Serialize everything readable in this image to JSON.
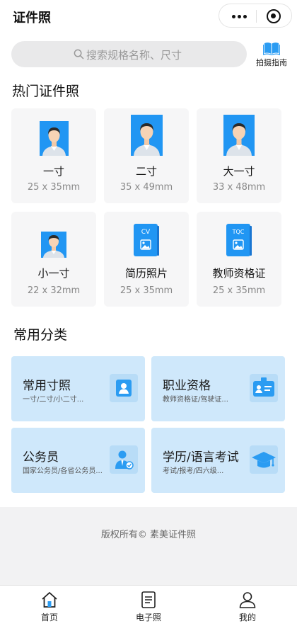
{
  "header": {
    "title": "证件照"
  },
  "search": {
    "placeholder": "搜索规格名称、尺寸"
  },
  "guide": {
    "label": "拍摄指南"
  },
  "hot": {
    "title": "热门证件照",
    "items": [
      {
        "name": "一寸",
        "size": "25 x 35mm"
      },
      {
        "name": "二寸",
        "size": "35 x 49mm"
      },
      {
        "name": "大一寸",
        "size": "33 x 48mm"
      },
      {
        "name": "小一寸",
        "size": "22 x 32mm"
      },
      {
        "name": "简历照片",
        "size": "25 x 35mm",
        "badge": "CV"
      },
      {
        "name": "教师资格证",
        "size": "25 x 35mm",
        "badge": "TQC"
      }
    ]
  },
  "categories": {
    "title": "常用分类",
    "items": [
      {
        "title": "常用寸照",
        "sub": "一寸/二寸/小二寸..."
      },
      {
        "title": "职业资格",
        "sub": "教师资格证/驾驶证..."
      },
      {
        "title": "公务员",
        "sub": "国家公务员/各省公务员..."
      },
      {
        "title": "学历/语言考试",
        "sub": "考试/报考/四六级..."
      }
    ]
  },
  "footer": {
    "copyright": "版权所有© 素美证件照"
  },
  "tabs": [
    {
      "label": "首页"
    },
    {
      "label": "电子照"
    },
    {
      "label": "我的"
    }
  ],
  "colors": {
    "accent": "#2b9cf2",
    "category_bg": "#cfe8fb",
    "photo_bg": "#2196f3"
  }
}
